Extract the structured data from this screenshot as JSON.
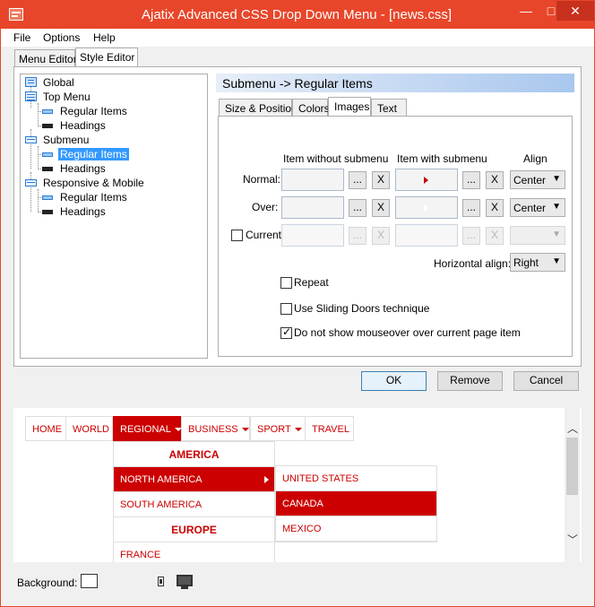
{
  "window": {
    "title": "Ajatix Advanced CSS Drop Down Menu - [news.css]",
    "minimize": "—",
    "maximize": "□",
    "close": "✕"
  },
  "menubar": [
    "File",
    "Options",
    "Help"
  ],
  "outer_tabs": [
    "Menu Editor",
    "Style Editor"
  ],
  "tree": {
    "global": "Global",
    "top_menu": "Top Menu",
    "top_regular": "Regular Items",
    "top_headings": "Headings",
    "submenu": "Submenu",
    "sub_regular": "Regular Items",
    "sub_headings": "Headings",
    "responsive": "Responsive & Mobile",
    "resp_regular": "Regular Items",
    "resp_headings": "Headings"
  },
  "section_title": "Submenu -> Regular Items",
  "inner_tabs": [
    "Size & Position",
    "Colors",
    "Images",
    "Text"
  ],
  "images": {
    "col_without": "Item without submenu",
    "col_with": "Item with submenu",
    "col_align": "Align",
    "row_normal": "Normal:",
    "row_over": "Over:",
    "row_current": "Current",
    "browse": "...",
    "clear": "X",
    "align_normal": "Center",
    "align_over": "Center",
    "align_current": "",
    "horizontal_align_label": "Horizontal align:",
    "horizontal_align_value": "Right",
    "repeat": "Repeat",
    "sliding_doors": "Use Sliding Doors technique",
    "no_mouseover": "Do not show mouseover over current page item"
  },
  "buttons": {
    "ok": "OK",
    "remove": "Remove",
    "cancel": "Cancel"
  },
  "preview": {
    "nav": [
      "HOME",
      "WORLD",
      "REGIONAL",
      "BUSINESS",
      "SPORT",
      "TRAVEL"
    ],
    "col1": [
      "AMERICA",
      "NORTH AMERICA",
      "SOUTH AMERICA",
      "EUROPE",
      "FRANCE"
    ],
    "col2": [
      "UNITED STATES",
      "CANADA",
      "MEXICO"
    ]
  },
  "bottom": {
    "background_label": "Background:"
  },
  "colors": {
    "accent": "#e8462a",
    "menu_red": "#cc0000",
    "selection": "#3399ff"
  }
}
